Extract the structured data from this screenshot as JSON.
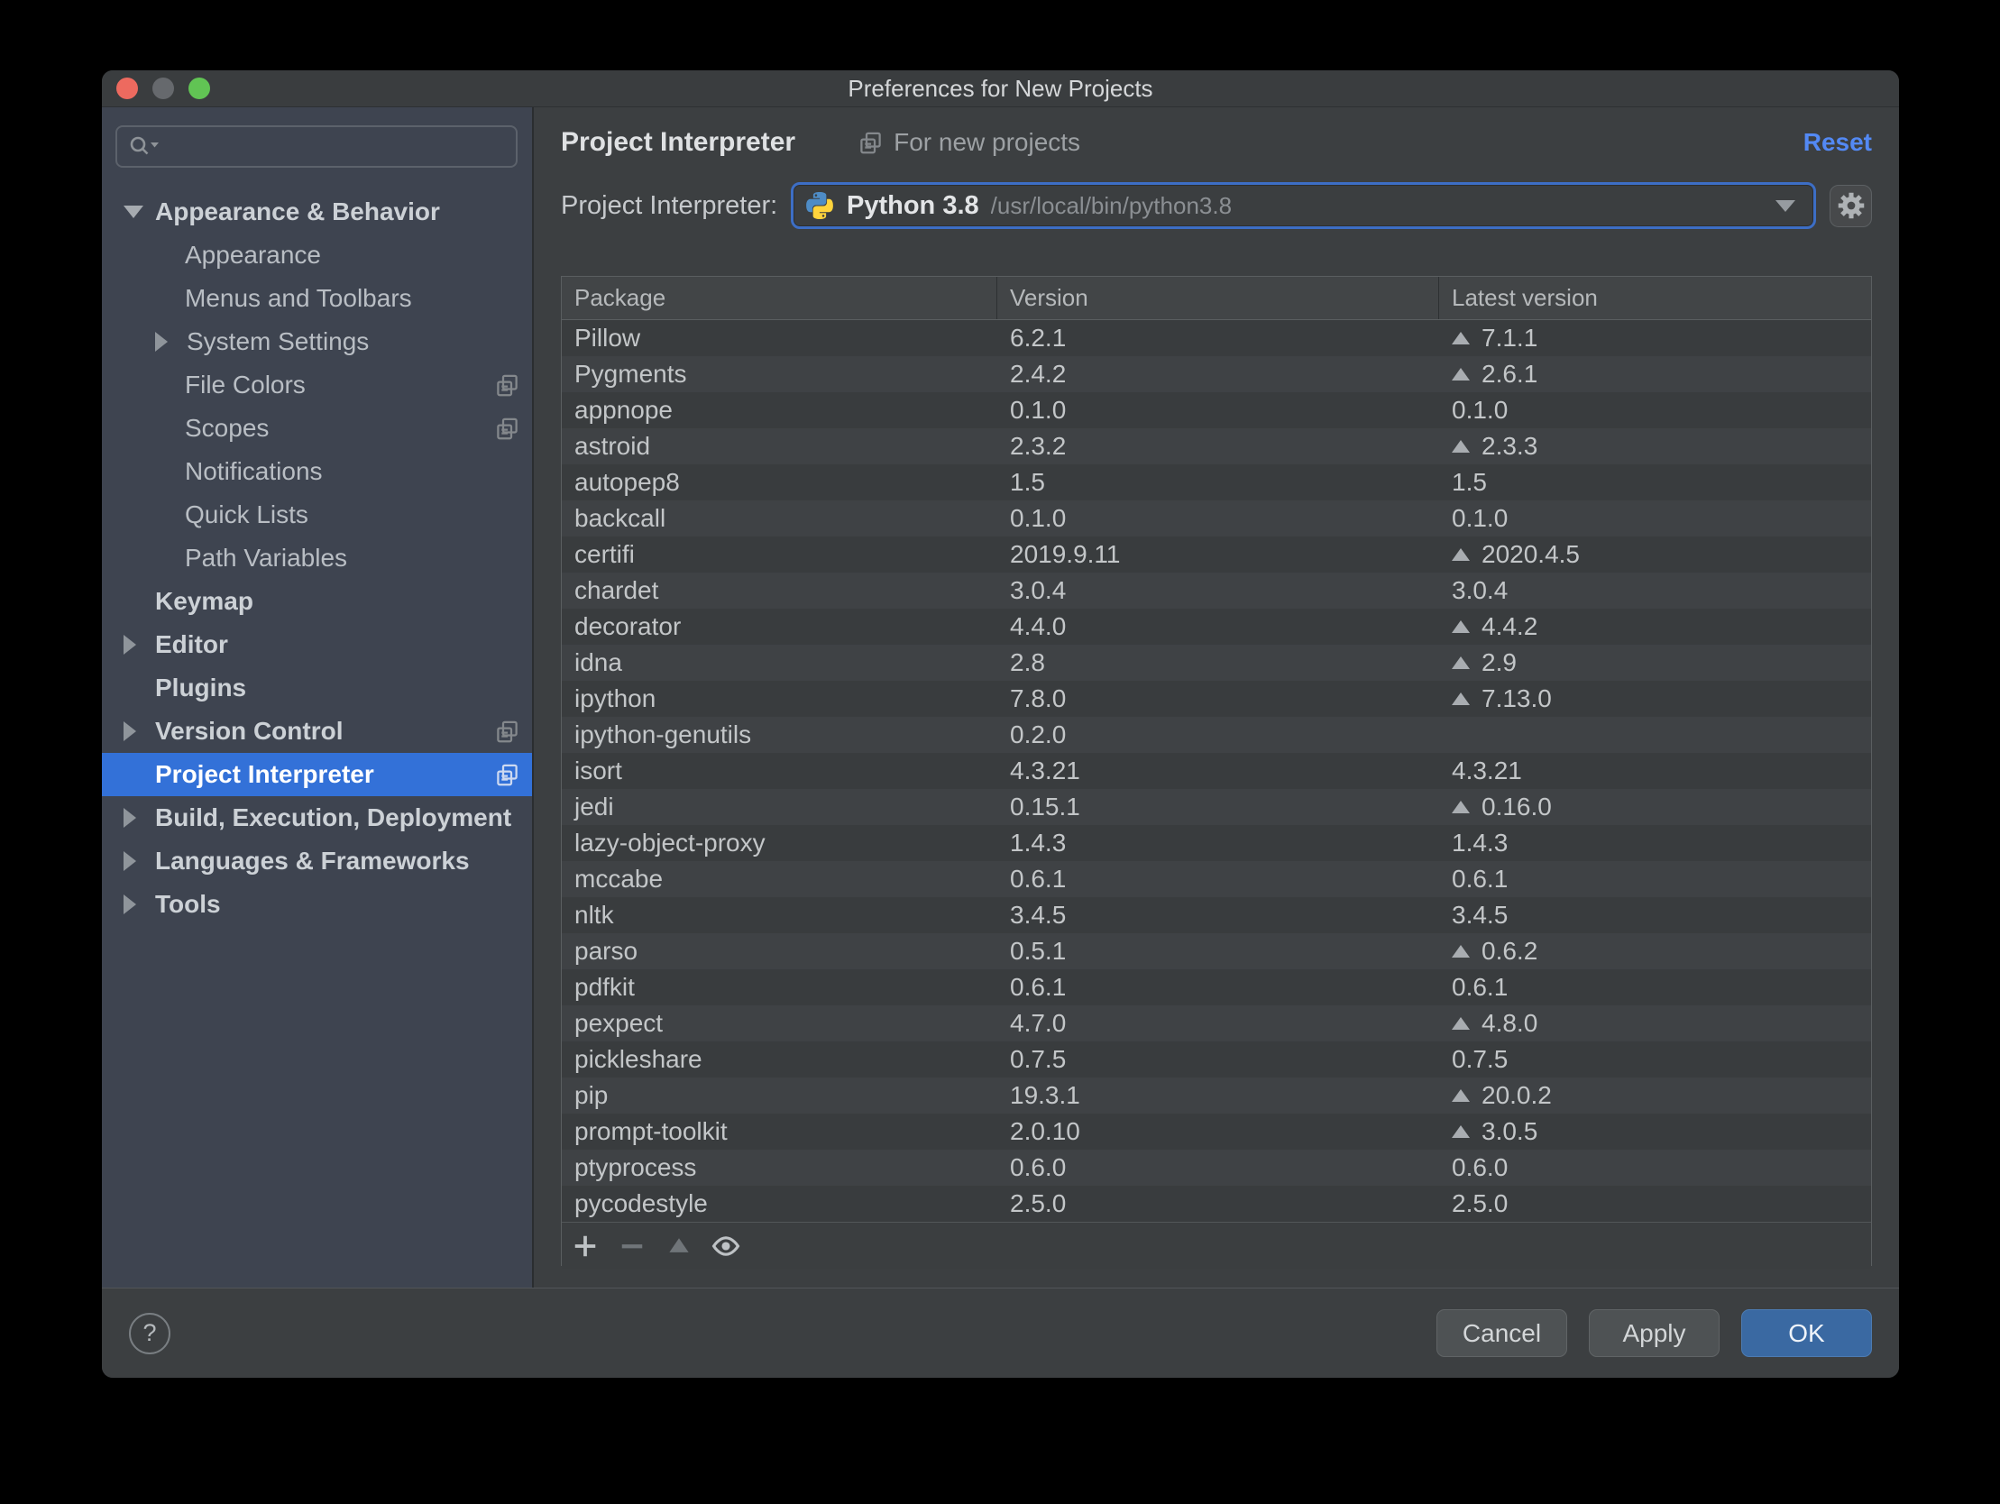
{
  "window": {
    "title": "Preferences for New Projects"
  },
  "sidebar": {
    "items": [
      {
        "label": "Appearance & Behavior",
        "level": 0,
        "bold": true,
        "expand": "expanded",
        "copy_badge": false,
        "selected": false
      },
      {
        "label": "Appearance",
        "level": 1,
        "bold": false,
        "expand": "none",
        "copy_badge": false,
        "selected": false
      },
      {
        "label": "Menus and Toolbars",
        "level": 1,
        "bold": false,
        "expand": "none",
        "copy_badge": false,
        "selected": false
      },
      {
        "label": "System Settings",
        "level": 1,
        "bold": false,
        "expand": "collapsed",
        "copy_badge": false,
        "selected": false
      },
      {
        "label": "File Colors",
        "level": 1,
        "bold": false,
        "expand": "none",
        "copy_badge": true,
        "selected": false
      },
      {
        "label": "Scopes",
        "level": 1,
        "bold": false,
        "expand": "none",
        "copy_badge": true,
        "selected": false
      },
      {
        "label": "Notifications",
        "level": 1,
        "bold": false,
        "expand": "none",
        "copy_badge": false,
        "selected": false
      },
      {
        "label": "Quick Lists",
        "level": 1,
        "bold": false,
        "expand": "none",
        "copy_badge": false,
        "selected": false
      },
      {
        "label": "Path Variables",
        "level": 1,
        "bold": false,
        "expand": "none",
        "copy_badge": false,
        "selected": false
      },
      {
        "label": "Keymap",
        "level": 0,
        "bold": true,
        "expand": "none",
        "copy_badge": false,
        "selected": false
      },
      {
        "label": "Editor",
        "level": 0,
        "bold": true,
        "expand": "collapsed",
        "copy_badge": false,
        "selected": false
      },
      {
        "label": "Plugins",
        "level": 0,
        "bold": true,
        "expand": "none",
        "copy_badge": false,
        "selected": false
      },
      {
        "label": "Version Control",
        "level": 0,
        "bold": true,
        "expand": "collapsed",
        "copy_badge": true,
        "selected": false
      },
      {
        "label": "Project Interpreter",
        "level": 0,
        "bold": true,
        "expand": "none",
        "copy_badge": true,
        "selected": true
      },
      {
        "label": "Build, Execution, Deployment",
        "level": 0,
        "bold": true,
        "expand": "collapsed",
        "copy_badge": false,
        "selected": false
      },
      {
        "label": "Languages & Frameworks",
        "level": 0,
        "bold": true,
        "expand": "collapsed",
        "copy_badge": false,
        "selected": false
      },
      {
        "label": "Tools",
        "level": 0,
        "bold": true,
        "expand": "collapsed",
        "copy_badge": false,
        "selected": false
      }
    ]
  },
  "header": {
    "title": "Project Interpreter",
    "scope_note": "For new projects",
    "reset_label": "Reset"
  },
  "interpreter": {
    "label": "Project Interpreter:",
    "name": "Python 3.8",
    "path": "/usr/local/bin/python3.8"
  },
  "packages": {
    "columns": [
      "Package",
      "Version",
      "Latest version"
    ],
    "rows": [
      {
        "package": "Pillow",
        "version": "6.2.1",
        "latest": "7.1.1",
        "upgrade": true
      },
      {
        "package": "Pygments",
        "version": "2.4.2",
        "latest": "2.6.1",
        "upgrade": true
      },
      {
        "package": "appnope",
        "version": "0.1.0",
        "latest": "0.1.0",
        "upgrade": false
      },
      {
        "package": "astroid",
        "version": "2.3.2",
        "latest": "2.3.3",
        "upgrade": true
      },
      {
        "package": "autopep8",
        "version": "1.5",
        "latest": "1.5",
        "upgrade": false
      },
      {
        "package": "backcall",
        "version": "0.1.0",
        "latest": "0.1.0",
        "upgrade": false
      },
      {
        "package": "certifi",
        "version": "2019.9.11",
        "latest": "2020.4.5",
        "upgrade": true
      },
      {
        "package": "chardet",
        "version": "3.0.4",
        "latest": "3.0.4",
        "upgrade": false
      },
      {
        "package": "decorator",
        "version": "4.4.0",
        "latest": "4.4.2",
        "upgrade": true
      },
      {
        "package": "idna",
        "version": "2.8",
        "latest": "2.9",
        "upgrade": true
      },
      {
        "package": "ipython",
        "version": "7.8.0",
        "latest": "7.13.0",
        "upgrade": true
      },
      {
        "package": "ipython-genutils",
        "version": "0.2.0",
        "latest": "",
        "upgrade": false
      },
      {
        "package": "isort",
        "version": "4.3.21",
        "latest": "4.3.21",
        "upgrade": false
      },
      {
        "package": "jedi",
        "version": "0.15.1",
        "latest": "0.16.0",
        "upgrade": true
      },
      {
        "package": "lazy-object-proxy",
        "version": "1.4.3",
        "latest": "1.4.3",
        "upgrade": false
      },
      {
        "package": "mccabe",
        "version": "0.6.1",
        "latest": "0.6.1",
        "upgrade": false
      },
      {
        "package": "nltk",
        "version": "3.4.5",
        "latest": "3.4.5",
        "upgrade": false
      },
      {
        "package": "parso",
        "version": "0.5.1",
        "latest": "0.6.2",
        "upgrade": true
      },
      {
        "package": "pdfkit",
        "version": "0.6.1",
        "latest": "0.6.1",
        "upgrade": false
      },
      {
        "package": "pexpect",
        "version": "4.7.0",
        "latest": "4.8.0",
        "upgrade": true
      },
      {
        "package": "pickleshare",
        "version": "0.7.5",
        "latest": "0.7.5",
        "upgrade": false
      },
      {
        "package": "pip",
        "version": "19.3.1",
        "latest": "20.0.2",
        "upgrade": true
      },
      {
        "package": "prompt-toolkit",
        "version": "2.0.10",
        "latest": "3.0.5",
        "upgrade": true
      },
      {
        "package": "ptyprocess",
        "version": "0.6.0",
        "latest": "0.6.0",
        "upgrade": false
      },
      {
        "package": "pycodestyle",
        "version": "2.5.0",
        "latest": "2.5.0",
        "upgrade": false
      }
    ],
    "toolbar_buttons": [
      {
        "name": "install-package",
        "icon": "plus-icon",
        "enabled": true
      },
      {
        "name": "uninstall-package",
        "icon": "minus-icon",
        "enabled": false
      },
      {
        "name": "upgrade-package",
        "icon": "up-triangle-icon",
        "enabled": false
      },
      {
        "name": "show-early-releases",
        "icon": "eye-icon",
        "enabled": true
      }
    ]
  },
  "footer": {
    "help_label": "?",
    "cancel_label": "Cancel",
    "apply_label": "Apply",
    "ok_label": "OK"
  },
  "colors": {
    "selection_blue": "#3371d8",
    "focus_ring_blue": "#3d6ec5",
    "link_blue": "#5389f4",
    "ok_button_blue": "#3a69a2",
    "python_blue": "#4e8cc6",
    "python_yellow": "#ffd43c",
    "traffic_red": "#ed6a5f",
    "traffic_gray": "#66696d",
    "traffic_green": "#61c454"
  }
}
